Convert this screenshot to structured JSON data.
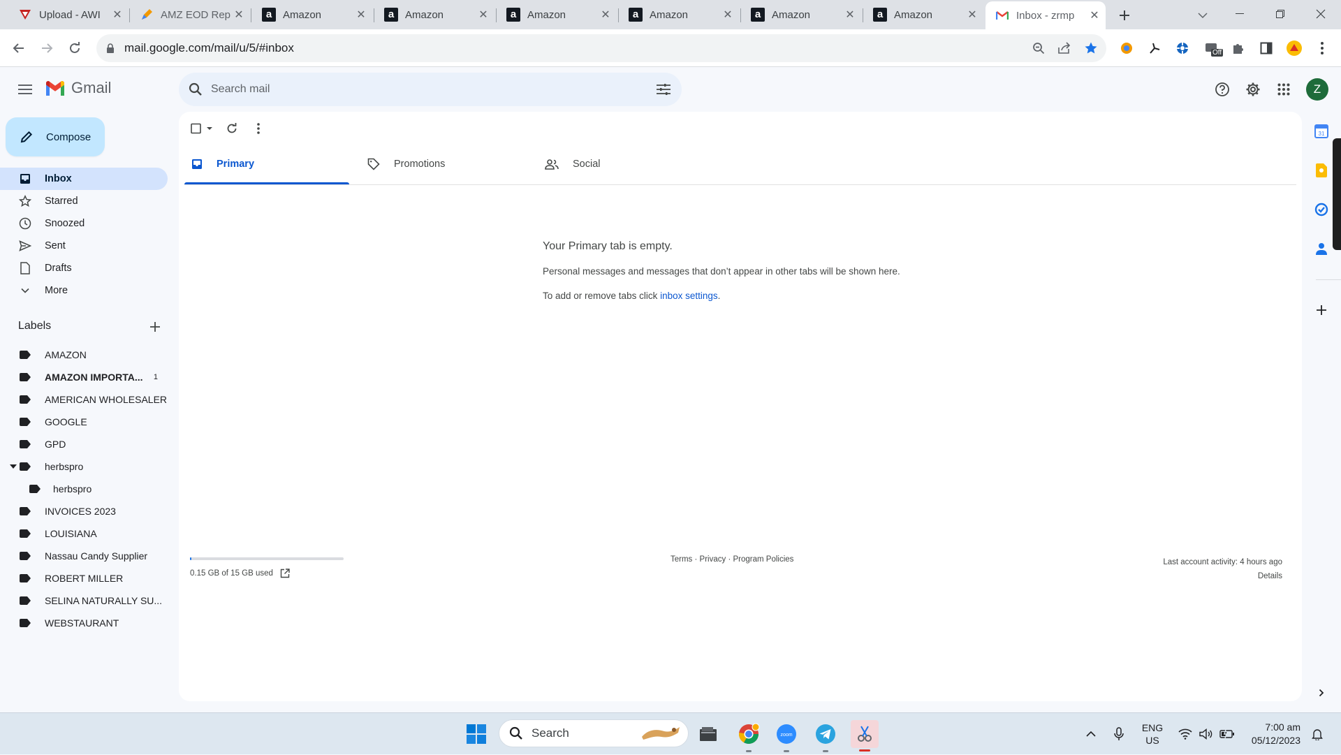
{
  "browser": {
    "tabs": [
      {
        "title": "Upload - AWI",
        "icon": "vertex-icon"
      },
      {
        "title": "AMZ EOD Rep",
        "icon": "pen-icon"
      },
      {
        "title": "Amazon",
        "icon": "amazon-icon"
      },
      {
        "title": "Amazon",
        "icon": "amazon-icon"
      },
      {
        "title": "Amazon",
        "icon": "amazon-icon"
      },
      {
        "title": "Amazon",
        "icon": "amazon-icon"
      },
      {
        "title": "Amazon",
        "icon": "amazon-icon"
      },
      {
        "title": "Amazon",
        "icon": "amazon-icon"
      },
      {
        "title": "Inbox - zrmp",
        "icon": "gmail-icon"
      }
    ],
    "url": "mail.google.com/mail/u/5/#inbox",
    "extension_badge": "Off"
  },
  "gmail": {
    "app_name": "Gmail",
    "search_placeholder": "Search mail",
    "avatar_letter": "Z",
    "compose_label": "Compose",
    "nav": [
      {
        "label": "Inbox",
        "icon": "inbox-icon"
      },
      {
        "label": "Starred",
        "icon": "star-icon"
      },
      {
        "label": "Snoozed",
        "icon": "clock-icon"
      },
      {
        "label": "Sent",
        "icon": "send-icon"
      },
      {
        "label": "Drafts",
        "icon": "draft-icon"
      },
      {
        "label": "More",
        "icon": "chevron-down-icon"
      }
    ],
    "labels_title": "Labels",
    "labels": [
      {
        "name": "AMAZON",
        "count": ""
      },
      {
        "name": "AMAZON IMPORTA...",
        "count": "1"
      },
      {
        "name": "AMERICAN WHOLESALER",
        "count": ""
      },
      {
        "name": "GOOGLE",
        "count": ""
      },
      {
        "name": "GPD",
        "count": ""
      },
      {
        "name": "herbspro",
        "count": ""
      },
      {
        "name": "herbspro",
        "count": ""
      },
      {
        "name": "INVOICES 2023",
        "count": ""
      },
      {
        "name": "LOUISIANA",
        "count": ""
      },
      {
        "name": "Nassau Candy Supplier",
        "count": ""
      },
      {
        "name": "ROBERT MILLER",
        "count": ""
      },
      {
        "name": "SELINA NATURALLY SU...",
        "count": ""
      },
      {
        "name": "WEBSTAURANT",
        "count": ""
      }
    ],
    "category_tabs": [
      {
        "label": "Primary",
        "icon": "inbox-tab-icon"
      },
      {
        "label": "Promotions",
        "icon": "tag-icon"
      },
      {
        "label": "Social",
        "icon": "people-icon"
      }
    ],
    "empty_title": "Your Primary tab is empty.",
    "empty_desc": "Personal messages and messages that don’t appear in other tabs will be shown here.",
    "empty_hint_prefix": "To add or remove tabs click ",
    "empty_hint_link": "inbox settings",
    "empty_hint_suffix": ".",
    "storage_text": "0.15 GB of 15 GB used",
    "storage_fraction": 0.01,
    "footer_terms": "Terms",
    "footer_privacy": "Privacy",
    "footer_policies": "Program Policies",
    "footer_sep": " · ",
    "activity_text": "Last account activity: 4 hours ago",
    "activity_details": "Details"
  },
  "taskbar": {
    "search_label": "Search",
    "lang_top": "ENG",
    "lang_bottom": "US",
    "time": "7:00 am",
    "date": "05/12/2023"
  }
}
